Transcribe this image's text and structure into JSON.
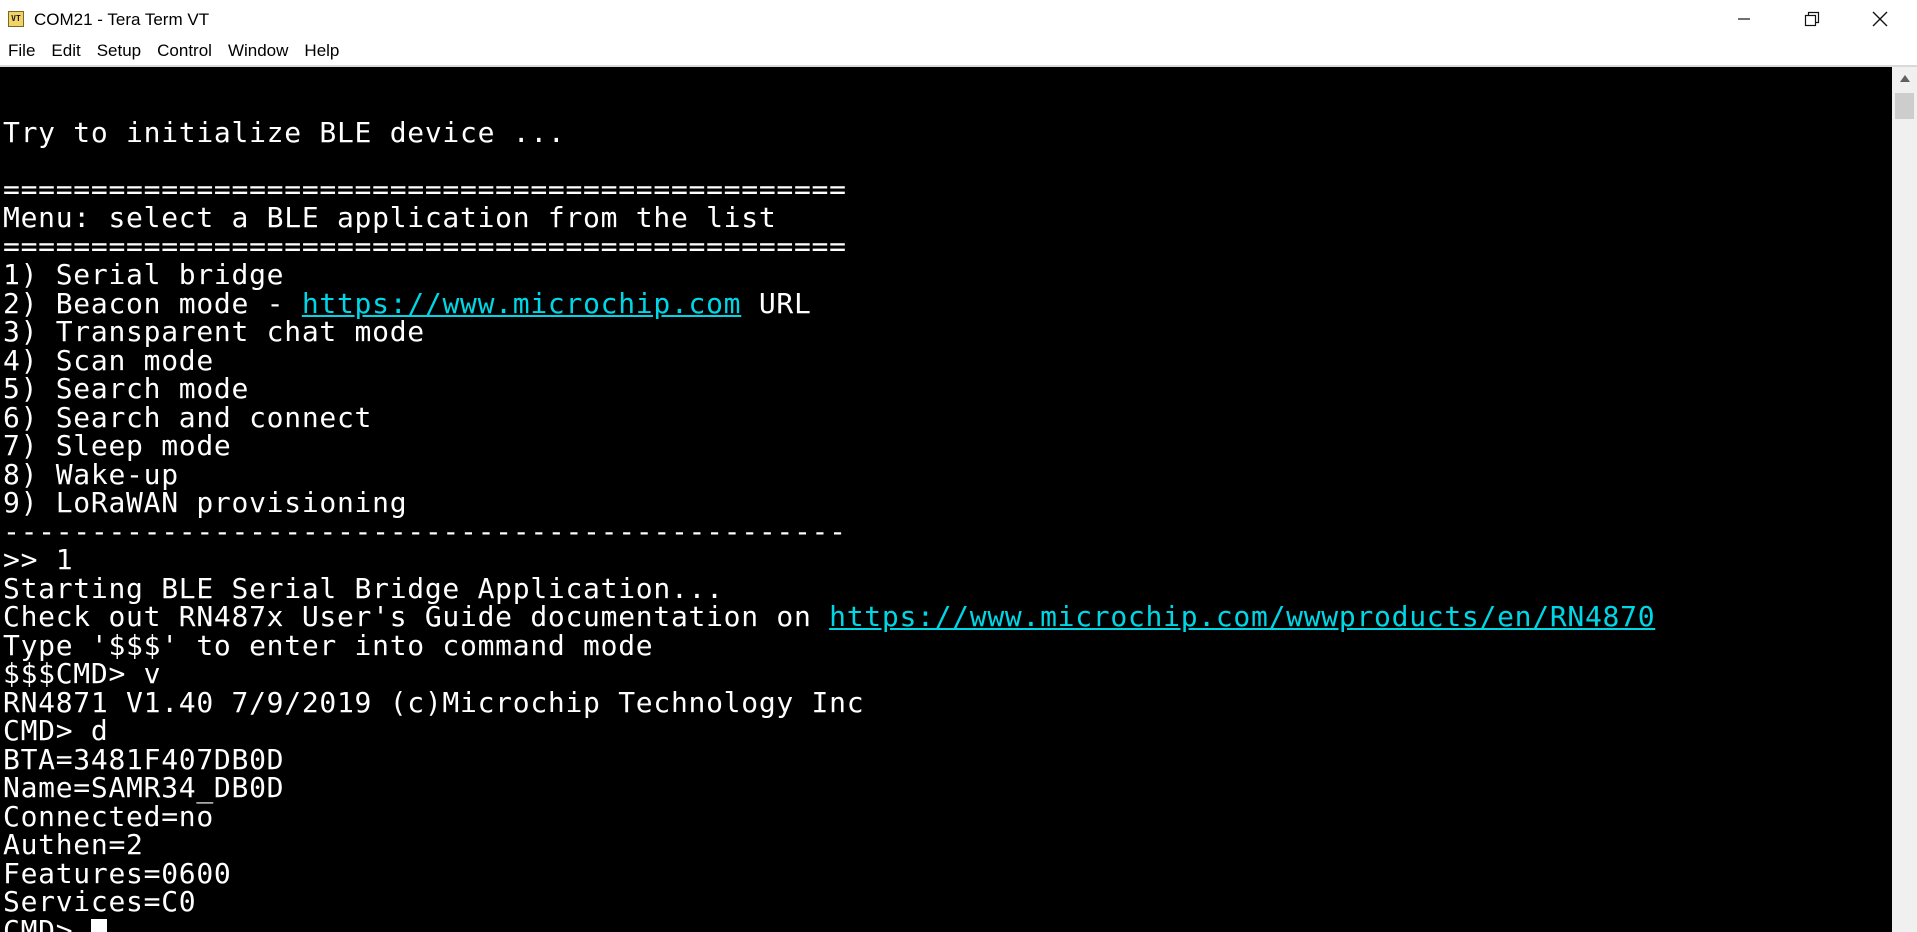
{
  "window": {
    "title": "COM21 - Tera Term VT",
    "icon_label": "VT",
    "controls": [
      "minimize",
      "restore",
      "close"
    ]
  },
  "menubar": {
    "items": [
      "File",
      "Edit",
      "Setup",
      "Control",
      "Window",
      "Help"
    ]
  },
  "terminal": {
    "lines": [
      {
        "segments": [
          {
            "text": ""
          }
        ]
      },
      {
        "segments": [
          {
            "text": "Try to initialize BLE device ..."
          }
        ]
      },
      {
        "segments": [
          {
            "text": ""
          }
        ]
      },
      {
        "segments": [
          {
            "text": "================================================"
          }
        ]
      },
      {
        "segments": [
          {
            "text": "Menu: select a BLE application from the list"
          }
        ]
      },
      {
        "segments": [
          {
            "text": "================================================"
          }
        ]
      },
      {
        "segments": [
          {
            "text": "1) Serial bridge"
          }
        ]
      },
      {
        "segments": [
          {
            "text": "2) Beacon mode - "
          },
          {
            "text": "https://www.microchip.com",
            "link": true
          },
          {
            "text": " URL"
          }
        ]
      },
      {
        "segments": [
          {
            "text": "3) Transparent chat mode"
          }
        ]
      },
      {
        "segments": [
          {
            "text": "4) Scan mode"
          }
        ]
      },
      {
        "segments": [
          {
            "text": "5) Search mode"
          }
        ]
      },
      {
        "segments": [
          {
            "text": "6) Search and connect"
          }
        ]
      },
      {
        "segments": [
          {
            "text": "7) Sleep mode"
          }
        ]
      },
      {
        "segments": [
          {
            "text": "8) Wake-up"
          }
        ]
      },
      {
        "segments": [
          {
            "text": "9) LoRaWAN provisioning"
          }
        ]
      },
      {
        "segments": [
          {
            "text": "------------------------------------------------"
          }
        ]
      },
      {
        "segments": [
          {
            "text": ">> 1"
          }
        ]
      },
      {
        "segments": [
          {
            "text": "Starting BLE Serial Bridge Application..."
          }
        ]
      },
      {
        "segments": [
          {
            "text": "Check out RN487x User's Guide documentation on "
          },
          {
            "text": "https://www.microchip.com/wwwproducts/en/RN4870",
            "link": true
          }
        ]
      },
      {
        "segments": [
          {
            "text": "Type '$$$' to enter into command mode"
          }
        ]
      },
      {
        "segments": [
          {
            "text": "$$$CMD> v"
          }
        ]
      },
      {
        "segments": [
          {
            "text": "RN4871 V1.40 7/9/2019 (c)Microchip Technology Inc"
          }
        ]
      },
      {
        "segments": [
          {
            "text": "CMD> d"
          }
        ]
      },
      {
        "segments": [
          {
            "text": "BTA=3481F407DB0D"
          }
        ]
      },
      {
        "segments": [
          {
            "text": "Name=SAMR34_DB0D"
          }
        ]
      },
      {
        "segments": [
          {
            "text": "Connected=no"
          }
        ]
      },
      {
        "segments": [
          {
            "text": "Authen=2"
          }
        ]
      },
      {
        "segments": [
          {
            "text": "Features=0600"
          }
        ]
      },
      {
        "segments": [
          {
            "text": "Services=C0"
          }
        ]
      },
      {
        "segments": [
          {
            "text": "CMD> "
          }
        ],
        "cursor": true
      }
    ]
  },
  "colors": {
    "terminal_bg": "#000000",
    "terminal_fg": "#ffffff",
    "link": "#00d7e6"
  }
}
